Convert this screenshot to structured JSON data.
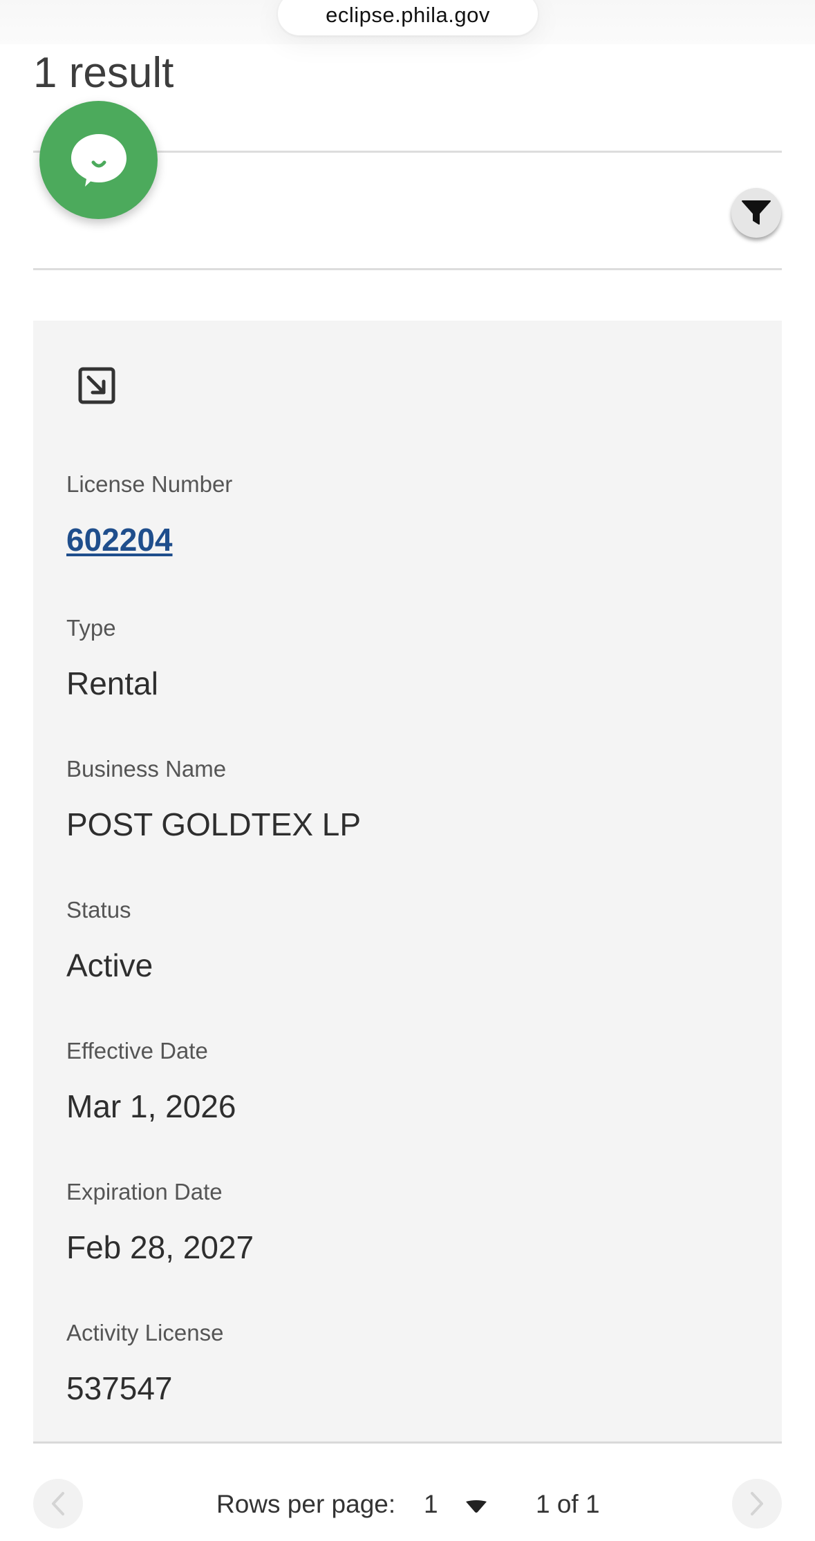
{
  "browser": {
    "url": "eclipse.phila.gov"
  },
  "results": {
    "count_label": "1 result"
  },
  "record": {
    "fields": [
      {
        "label": "License Number",
        "value": "602204"
      },
      {
        "label": "Type",
        "value": "Rental"
      },
      {
        "label": "Business Name",
        "value": "POST GOLDTEX LP"
      },
      {
        "label": "Status",
        "value": "Active"
      },
      {
        "label": "Effective Date",
        "value": "Mar 1, 2026"
      },
      {
        "label": "Expiration Date",
        "value": "Feb 28, 2027"
      },
      {
        "label": "Activity License",
        "value": "537547"
      }
    ]
  },
  "pagination": {
    "rows_per_page_label": "Rows per page:",
    "rows_per_page_value": "1",
    "page_info": "1 of 1"
  },
  "icons": {
    "chat": "chat-bubble-icon",
    "filter": "filter-icon",
    "expand": "expand-arrow-icon",
    "prev": "chevron-left-icon",
    "next": "chevron-right-icon",
    "dropdown": "caret-down-icon"
  },
  "colors": {
    "chat_button": "#4caa5c",
    "link": "#1f4e8c",
    "card_background": "#f4f4f4"
  }
}
